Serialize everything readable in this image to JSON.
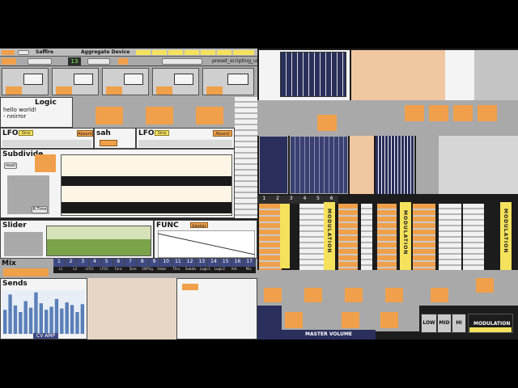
{
  "topbar": {
    "device": "Saffire",
    "aggregate": "Aggregate Device",
    "value": "13",
    "preset_label": "preset_scripting_ui"
  },
  "modules": {
    "logic": {
      "title": "Logic",
      "text": "hello world!\n- nnirror"
    },
    "lfo1": {
      "title": "LFO",
      "wave": "Sine",
      "mode": "Absent"
    },
    "sah": {
      "title": "sah",
      "mode": "on"
    },
    "lfo2": {
      "title": "LFO",
      "wave": "Sine",
      "mode": "Absent"
    },
    "subdivide": {
      "title": "Subdivide",
      "reset": "reset",
      "btn": "R.Time"
    },
    "slider": {
      "title": "Slider"
    },
    "func": {
      "title": "FUNC",
      "mode": "bipolar"
    },
    "mix": {
      "title": "Mix"
    },
    "sends": {
      "title": "Sends",
      "footer": "CV AMP"
    }
  },
  "mix_channels": [
    "1",
    "2",
    "3",
    "4",
    "5",
    "6",
    "7",
    "8",
    "9",
    "10",
    "11",
    "12",
    "13",
    "14",
    "15",
    "16",
    "17"
  ],
  "mix_labels": [
    "L1",
    "L2",
    "LFO1",
    "LFO2",
    "Func",
    "Sine",
    "SWTrig",
    "Slider",
    "Thru",
    "Subdiv",
    "Logic1",
    "Logic2",
    "Arb",
    "Mix"
  ],
  "sends_bars": [
    0.55,
    0.9,
    0.65,
    0.5,
    0.75,
    0.6,
    0.95,
    0.7,
    0.55,
    0.62,
    0.8,
    0.58,
    0.72,
    0.66,
    0.5,
    0.68
  ],
  "right": {
    "modulation_label": "MODULATION",
    "master_volume": "MASTER VOLUME",
    "low": "LOW",
    "mid": "MID",
    "hi": "HI",
    "modulation_btn": "MODULATION",
    "seq_numbers": [
      "1",
      "2",
      "3",
      "4",
      "5",
      "6"
    ],
    "vert_labels": [
      "MODULATION",
      "MODULATION",
      "MODULATION",
      "MODULATION"
    ]
  },
  "colors": {
    "accent": "#f0a04a",
    "panel": "#a9a9a9",
    "yellow": "#f5e25c",
    "dark": "#232323"
  }
}
